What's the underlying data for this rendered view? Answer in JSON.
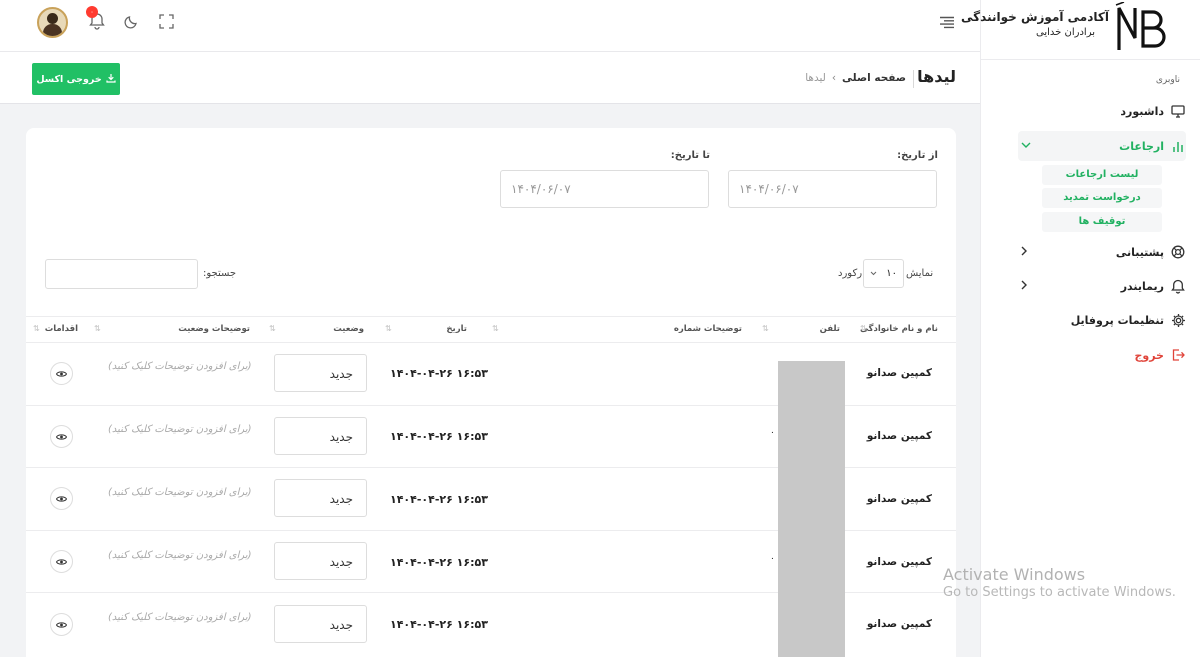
{
  "brand": {
    "logo_letters": "NB",
    "title": "آکادمی آموزش خوانندگی",
    "subtitle": "برادران خدایی"
  },
  "topbar": {
    "notification_count": "۰"
  },
  "sidebar": {
    "heading": "ناوبری",
    "items": [
      {
        "label": "داشبورد",
        "icon": "monitor-icon"
      },
      {
        "label": "ارجاعات",
        "icon": "chart-icon",
        "active": true
      },
      {
        "label": "پشتیبانی",
        "icon": "support-icon"
      },
      {
        "label": "ریمایندر",
        "icon": "bell-icon"
      },
      {
        "label": "تنظیمات پروفایل",
        "icon": "gear-icon"
      },
      {
        "label": "خروج",
        "icon": "logout-icon"
      }
    ],
    "subitems": [
      "لیست ارجاعات",
      "درخواست تمدید",
      "توقیف ها"
    ]
  },
  "header": {
    "title": "لیدها",
    "breadcrumb_home": "صفحه اصلی",
    "breadcrumb_sep": "›",
    "breadcrumb_current": "لیدها",
    "export_label": "خروجی اکسل"
  },
  "filters": {
    "from_label": "از تاریخ:",
    "to_label": "تا تاریخ:",
    "from_value": "۱۴۰۴/۰۶/۰۷",
    "to_value": "۱۴۰۴/۰۶/۰۷",
    "show_label": "نمایش",
    "page_size": "۱۰",
    "records_label": "رکورد",
    "search_label": "جستجو:"
  },
  "table": {
    "columns": [
      "نام و نام خانوادگی",
      "تلفن",
      "توضیحات شماره",
      "تاریخ",
      "وضعیت",
      "توضیحات وضعیت",
      "اقدامات"
    ],
    "rows": [
      {
        "name": "کمپین صدانو",
        "phone": "",
        "date": "۱۴۰۴-۰۴-۲۶ ۱۶:۵۳",
        "status": "جدید",
        "desc": "(برای افزودن توضیحات کلیک کنید)"
      },
      {
        "name": "کمپین صدانو",
        "phone": "۰",
        "date": "۱۴۰۴-۰۴-۲۶ ۱۶:۵۳",
        "status": "جدید",
        "desc": "(برای افزودن توضیحات کلیک کنید)"
      },
      {
        "name": "کمپین صدانو",
        "phone": "",
        "date": "۱۴۰۴-۰۴-۲۶ ۱۶:۵۳",
        "status": "جدید",
        "desc": "(برای افزودن توضیحات کلیک کنید)"
      },
      {
        "name": "کمپین صدانو",
        "phone": "۰",
        "date": "۱۴۰۴-۰۴-۲۶ ۱۶:۵۳",
        "status": "جدید",
        "desc": "(برای افزودن توضیحات کلیک کنید)"
      },
      {
        "name": "کمپین صدانو",
        "phone": "",
        "date": "۱۴۰۴-۰۴-۲۶ ۱۶:۵۳",
        "status": "جدید",
        "desc": "(برای افزودن توضیحات کلیک کنید)"
      }
    ]
  },
  "watermark": {
    "line1": "Activate Windows",
    "line2": "Go to Settings to activate Windows."
  },
  "colors": {
    "accent": "#21b161",
    "danger": "#e0443a",
    "badge": "#ff3b30"
  }
}
